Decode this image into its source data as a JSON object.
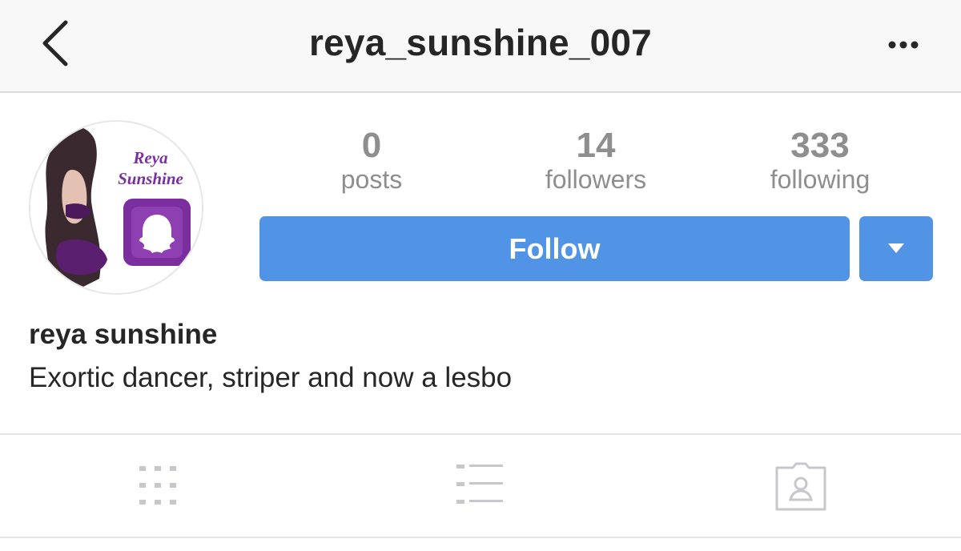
{
  "header": {
    "username": "reya_sunshine_007",
    "back_icon": "chevron-left-icon",
    "more_icon": "ellipsis-horizontal-icon"
  },
  "profile": {
    "avatar": {
      "icon": "profile-picture",
      "logo_text_line1": "Reya",
      "logo_text_line2": "Sunshine",
      "logo_icon": "snapchat-snapcode-icon",
      "logo_color": "#7b2f9e"
    },
    "stats": [
      {
        "value": "0",
        "label": "posts"
      },
      {
        "value": "14",
        "label": "followers"
      },
      {
        "value": "333",
        "label": "following"
      }
    ],
    "follow_label": "Follow",
    "dropdown_icon": "caret-down-icon",
    "display_name": "reya sunshine",
    "bio": "Exortic dancer, striper and now a lesbo"
  },
  "tabs": [
    {
      "name": "grid",
      "icon": "grid-icon"
    },
    {
      "name": "list",
      "icon": "list-icon"
    },
    {
      "name": "tagged",
      "icon": "tagged-person-icon"
    }
  ],
  "colors": {
    "accent": "#5194e6",
    "muted": "#8e8e8e",
    "icon_gray": "#c7c7cc",
    "text": "#262626"
  }
}
